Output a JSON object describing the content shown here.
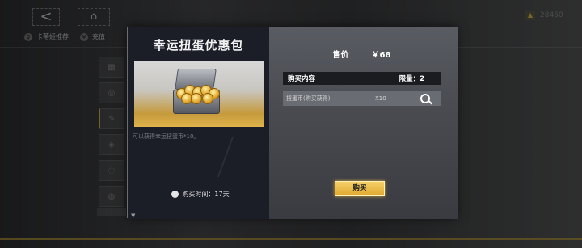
{
  "background": {
    "back_icon": "<",
    "home_icon": "⌂",
    "currency_icon": "▲",
    "currency_value": "28460",
    "tabs": [
      {
        "icon": "♀",
        "label": "卡蒂娅推荐"
      },
      {
        "icon": "¥",
        "label": "充值"
      }
    ],
    "side_icons": [
      "▦",
      "◎",
      "✎",
      "◈",
      "◌",
      "◍"
    ]
  },
  "dialog": {
    "package_title": "幸运扭蛋优惠包",
    "description": "可以获得幸运扭蛋币*10。",
    "purchase_time": "购买时间：17天",
    "price_label": "售价",
    "price_value": "￥68",
    "contents_label": "购买内容",
    "limit_label": "限量：2",
    "items": [
      {
        "name": "扭蛋币(购买获得)",
        "quantity": "X10"
      }
    ],
    "buy_button": "购买",
    "colors": {
      "accent": "#e1a92f",
      "panel_dark": "#1b1d27",
      "panel_gray": "#4a4c52"
    }
  }
}
